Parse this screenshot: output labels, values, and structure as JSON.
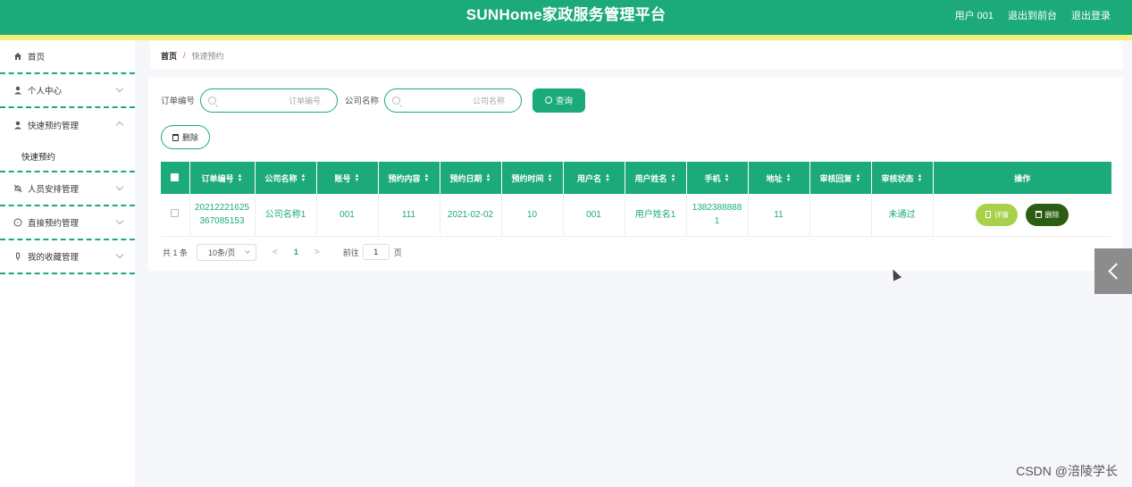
{
  "header": {
    "title": "SUNHome家政服务管理平台",
    "user": "用户 001",
    "back_front": "退出到前台",
    "logout": "退出登录"
  },
  "colors": {
    "primary": "#1daa7b",
    "accent_bar": "#f4ef78",
    "detail_btn": "#a8d14b",
    "delete_btn": "#2d5c14"
  },
  "sidebar": {
    "items": [
      {
        "label": "首页",
        "icon": "home-icon"
      },
      {
        "label": "个人中心",
        "icon": "user-icon"
      },
      {
        "label": "快速预约管理",
        "icon": "user-icon",
        "expanded": true
      },
      {
        "label": "快速预约",
        "sub": true
      },
      {
        "label": "人员安排管理",
        "icon": "bell-off-icon"
      },
      {
        "label": "直接预约管理",
        "icon": "compass-icon"
      },
      {
        "label": "我的收藏管理",
        "icon": "mic-icon"
      }
    ]
  },
  "breadcrumb": {
    "home": "首页",
    "sep": "/",
    "current": "快速预约"
  },
  "search": {
    "order_label": "订单编号",
    "order_placeholder": "订单编号",
    "company_label": "公司名称",
    "company_placeholder": "公司名称",
    "query_label": "查询"
  },
  "toolbar": {
    "delete_label": "删除"
  },
  "table": {
    "headers": [
      "订单编号",
      "公司名称",
      "账号",
      "预约内容",
      "预约日期",
      "预约时间",
      "用户名",
      "用户姓名",
      "手机",
      "地址",
      "审核回复",
      "审核状态",
      "操作"
    ],
    "rows": [
      {
        "order_no": "20212221625367085153",
        "company": "公司名称1",
        "account": "001",
        "content": "111",
        "date": "2021-02-02",
        "time": "10",
        "username": "001",
        "realname": "用户姓名1",
        "phone": "13823888881",
        "address": "11",
        "reply": "",
        "status": "未通过",
        "detail_label": "详情",
        "delete_label": "删除"
      }
    ]
  },
  "pager": {
    "total": "共 1 条",
    "page_size": "10条/页",
    "prev": "<",
    "current": "1",
    "next": ">",
    "goto_label": "前往",
    "goto_value": "1",
    "page_unit": "页"
  },
  "watermark": "CSDN @涪陵学长"
}
